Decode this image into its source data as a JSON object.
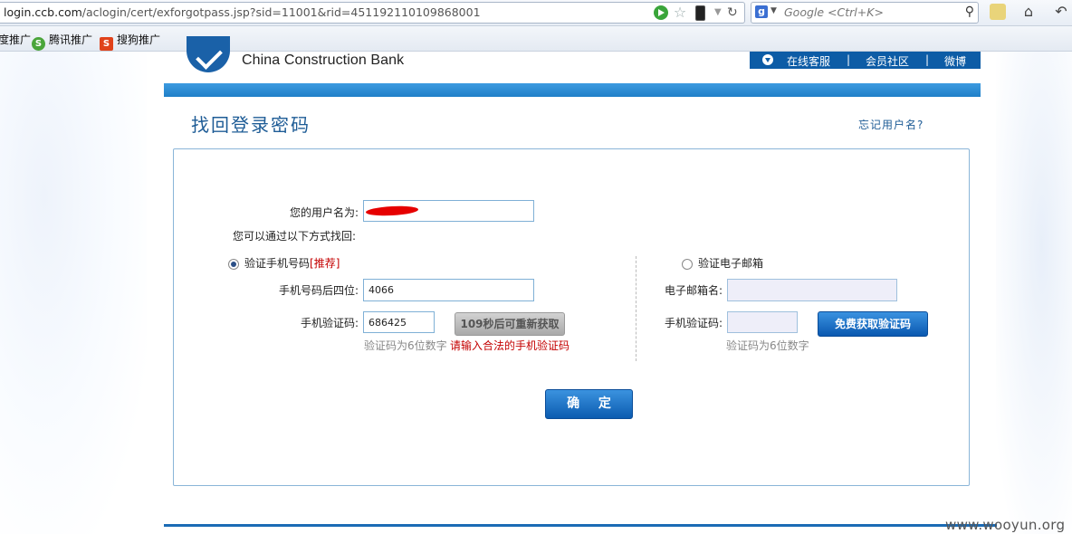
{
  "browser": {
    "url_host": "login.ccb.com",
    "url_path": "/aclogin/cert/exforgotpass.jsp?sid=11001&rid=451192110109868001",
    "search_placeholder": "Google <Ctrl+K>",
    "search_engine_icon": "g",
    "bookmarks": [
      {
        "label": "度推广",
        "icon": ""
      },
      {
        "label": "腾讯推广",
        "icon": "S"
      },
      {
        "label": "搜狗推广",
        "icon": "S"
      }
    ]
  },
  "header": {
    "brand": "China Construction Bank",
    "nav": [
      "在线客服",
      "|",
      "会员社区",
      "|",
      "微博"
    ]
  },
  "page": {
    "title": "找回登录密码",
    "forgot_username": "忘记用户名?"
  },
  "form": {
    "username_label": "您的用户名为:",
    "recover_intro": "您可以通过以下方式找回:",
    "phone_option": {
      "label": "验证手机号码",
      "recommend": "[推荐]",
      "last4_label": "手机号码后四位:",
      "last4_value": "4066",
      "code_label": "手机验证码:",
      "code_value": "686425",
      "resend_button": "109秒后可重新获取",
      "hint": "验证码为6位数字",
      "error": "请输入合法的手机验证码",
      "selected": true
    },
    "email_option": {
      "label": "验证电子邮箱",
      "email_label": "电子邮箱名:",
      "email_value": "",
      "code_label": "手机验证码:",
      "code_value": "",
      "get_code_button": "免费获取验证码",
      "hint": "验证码为6位数字",
      "selected": false
    },
    "submit_button": "确 定"
  },
  "watermark": "www.wooyun.org"
}
